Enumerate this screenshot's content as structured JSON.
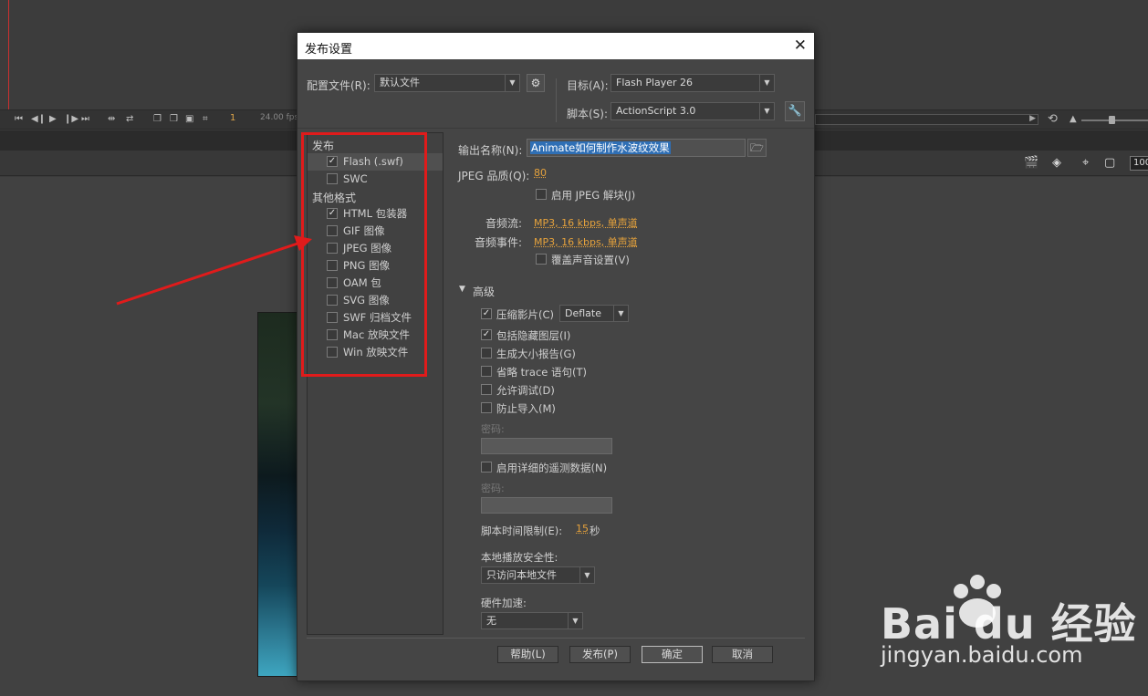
{
  "workspace": {
    "frame_number": "1",
    "fps": "24.00 fps",
    "zoom": "100"
  },
  "dialog": {
    "title": "发布设置",
    "profile_label": "配置文件(R):",
    "profile_value": "默认文件",
    "target_label": "目标(A):",
    "target_value": "Flash Player 26",
    "script_label": "脚本(S):",
    "script_value": "ActionScript 3.0",
    "publish_group": "发布",
    "other_formats_group": "其他格式",
    "items": [
      {
        "label": "Flash (.swf)",
        "checked": true
      },
      {
        "label": "SWC",
        "checked": false
      },
      {
        "label": "HTML 包装器",
        "checked": true
      },
      {
        "label": "GIF 图像",
        "checked": false
      },
      {
        "label": "JPEG 图像",
        "checked": false
      },
      {
        "label": "PNG 图像",
        "checked": false
      },
      {
        "label": "OAM 包",
        "checked": false
      },
      {
        "label": "SVG 图像",
        "checked": false
      },
      {
        "label": "SWF 归档文件",
        "checked": false
      },
      {
        "label": "Mac 放映文件",
        "checked": false
      },
      {
        "label": "Win 放映文件",
        "checked": false
      }
    ],
    "output_name_label": "输出名称(N):",
    "output_name_value": "Animate如何制作水波纹效果",
    "jpeg_quality_label": "JPEG 品质(Q):",
    "jpeg_quality_value": "80",
    "enable_jpeg_deblock": "启用 JPEG 解块(J)",
    "audio_stream_label": "音频流:",
    "audio_stream_value": "MP3, 16 kbps, 单声道",
    "audio_event_label": "音频事件:",
    "audio_event_value": "MP3, 16 kbps, 单声道",
    "override_sound": "覆盖声音设置(V)",
    "advanced_label": "高级",
    "compress_movie": "压缩影片(C)",
    "compress_value": "Deflate",
    "include_hidden": "包括隐藏图层(I)",
    "size_report": "生成大小报告(G)",
    "omit_trace": "省略 trace 语句(T)",
    "permit_debug": "允许调试(D)",
    "protect_import": "防止导入(M)",
    "password_label_1": "密码:",
    "enable_telemetry": "启用详细的遥测数据(N)",
    "password_label_2": "密码:",
    "script_time_limit_label": "脚本时间限制(E):",
    "script_time_limit_value": "15",
    "script_time_unit": "秒",
    "local_playback_label": "本地播放安全性:",
    "local_playback_value": "只访问本地文件",
    "hardware_accel_label": "硬件加速:",
    "hardware_accel_value": "无",
    "help_button": "帮助(L)",
    "publish_button": "发布(P)",
    "ok_button": "确定",
    "cancel_button": "取消"
  },
  "watermark": {
    "brand": "Bai du 经验",
    "url": "jingyan.baidu.com"
  },
  "colors": {
    "annotation_red": "#e01b1b",
    "link_orange": "#e6a23c",
    "selection_blue": "#2f6fb5"
  }
}
